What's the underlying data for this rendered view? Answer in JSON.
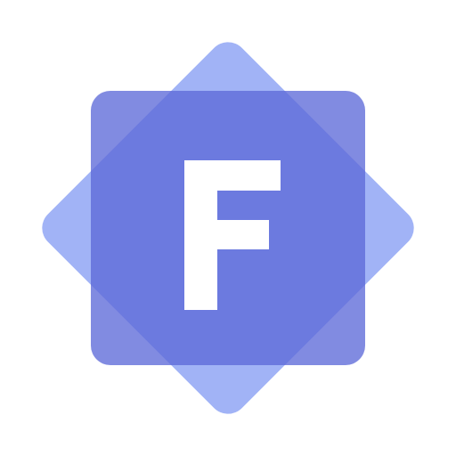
{
  "logo": {
    "letter": "F",
    "colors": {
      "background": "#ffffff",
      "rotated_square": "#a1b3f6",
      "front_square": "#5d6ad9",
      "overlap": "#6a7ce2",
      "letter": "#ffffff"
    }
  }
}
